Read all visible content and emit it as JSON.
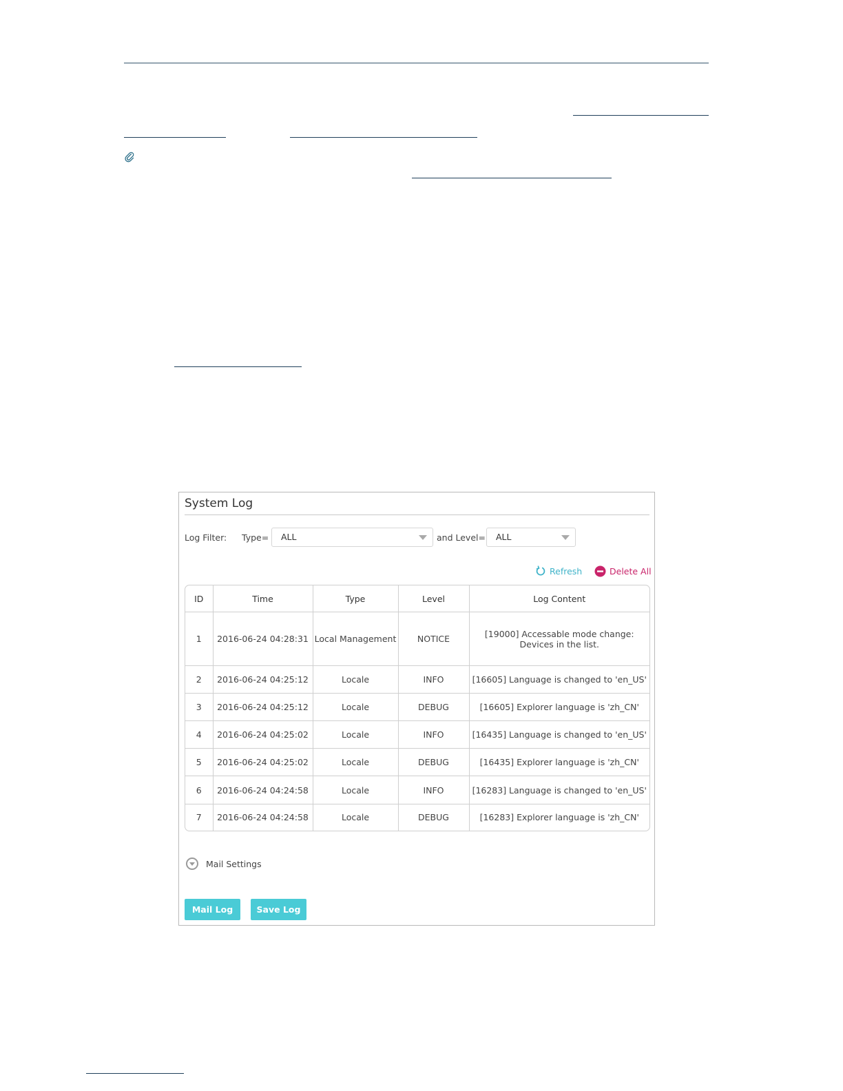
{
  "panel": {
    "title": "System Log",
    "filter": {
      "label": "Log Filter:",
      "type_label": "Type=",
      "type_value": "ALL",
      "level_label": "and Level=",
      "level_value": "ALL"
    },
    "actions": {
      "refresh": "Refresh",
      "delete_all": "Delete All"
    },
    "table": {
      "headers": [
        "ID",
        "Time",
        "Type",
        "Level",
        "Log Content"
      ],
      "rows": [
        [
          "1",
          "2016-06-24 04:28:31",
          "Local Management",
          "NOTICE",
          "[19000] Accessable mode change: Devices in the list."
        ],
        [
          "2",
          "2016-06-24 04:25:12",
          "Locale",
          "INFO",
          "[16605] Language is changed to 'en_US'"
        ],
        [
          "3",
          "2016-06-24 04:25:12",
          "Locale",
          "DEBUG",
          "[16605] Explorer language is 'zh_CN'"
        ],
        [
          "4",
          "2016-06-24 04:25:02",
          "Locale",
          "INFO",
          "[16435] Language is changed to 'en_US'"
        ],
        [
          "5",
          "2016-06-24 04:25:02",
          "Locale",
          "DEBUG",
          "[16435] Explorer language is 'zh_CN'"
        ],
        [
          "6",
          "2016-06-24 04:24:58",
          "Locale",
          "INFO",
          "[16283] Language is changed to 'en_US'"
        ],
        [
          "7",
          "2016-06-24 04:24:58",
          "Locale",
          "DEBUG",
          "[16283] Explorer language is 'zh_CN'"
        ]
      ]
    },
    "mail_settings": "Mail Settings",
    "buttons": {
      "mail_log": "Mail Log",
      "save_log": "Save Log"
    }
  },
  "colors": {
    "accent_button": "#4acbd6",
    "refresh": "#3fb3c9",
    "delete": "#c9246a"
  }
}
